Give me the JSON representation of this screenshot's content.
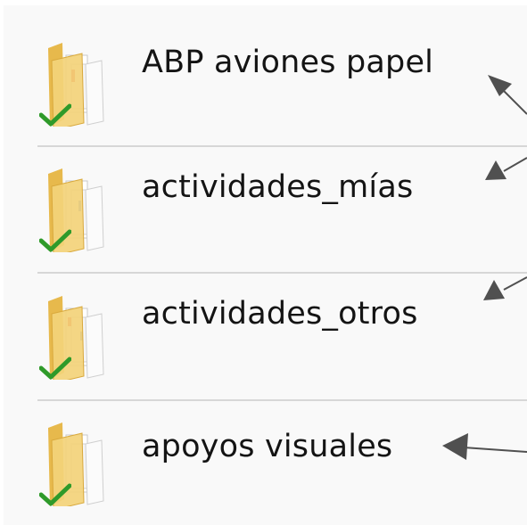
{
  "file_list": {
    "items": [
      {
        "name": "ABP aviones papel",
        "sync_status": "synced"
      },
      {
        "name": "actividades_mías",
        "sync_status": "synced"
      },
      {
        "name": "actividades_otros",
        "sync_status": "synced"
      },
      {
        "name": "apoyos visuales",
        "sync_status": "synced"
      }
    ]
  },
  "colors": {
    "background": "#f9f9f9",
    "divider": "#d7d7d7",
    "text": "#141414",
    "check": "#2f9a2a",
    "folder": "#f3d37a",
    "arrow": "#505050"
  },
  "icons": {
    "folder": "folder-icon",
    "status": "sync-check-icon",
    "annotation": "arrow-icon"
  }
}
